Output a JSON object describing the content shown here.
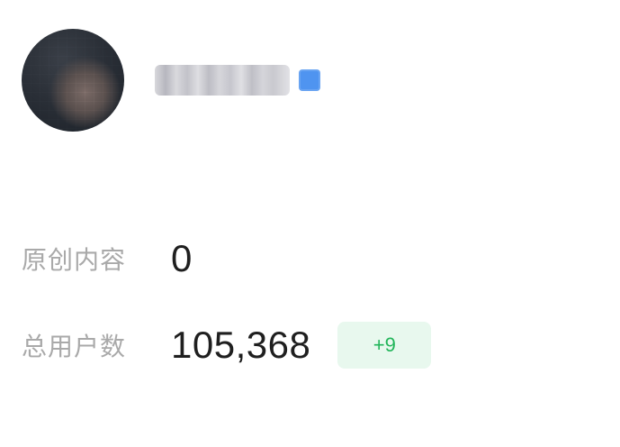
{
  "profile": {
    "username": "",
    "verified_badge_color": "#4f94f0"
  },
  "stats": [
    {
      "label": "原创内容",
      "value": "0"
    },
    {
      "label": "总用户数",
      "value": "105,368",
      "delta": "+9"
    }
  ],
  "colors": {
    "label": "#a9a9a9",
    "value": "#1f1f1f",
    "delta_text": "#22b55a",
    "delta_bg": "#e8f8ee"
  }
}
